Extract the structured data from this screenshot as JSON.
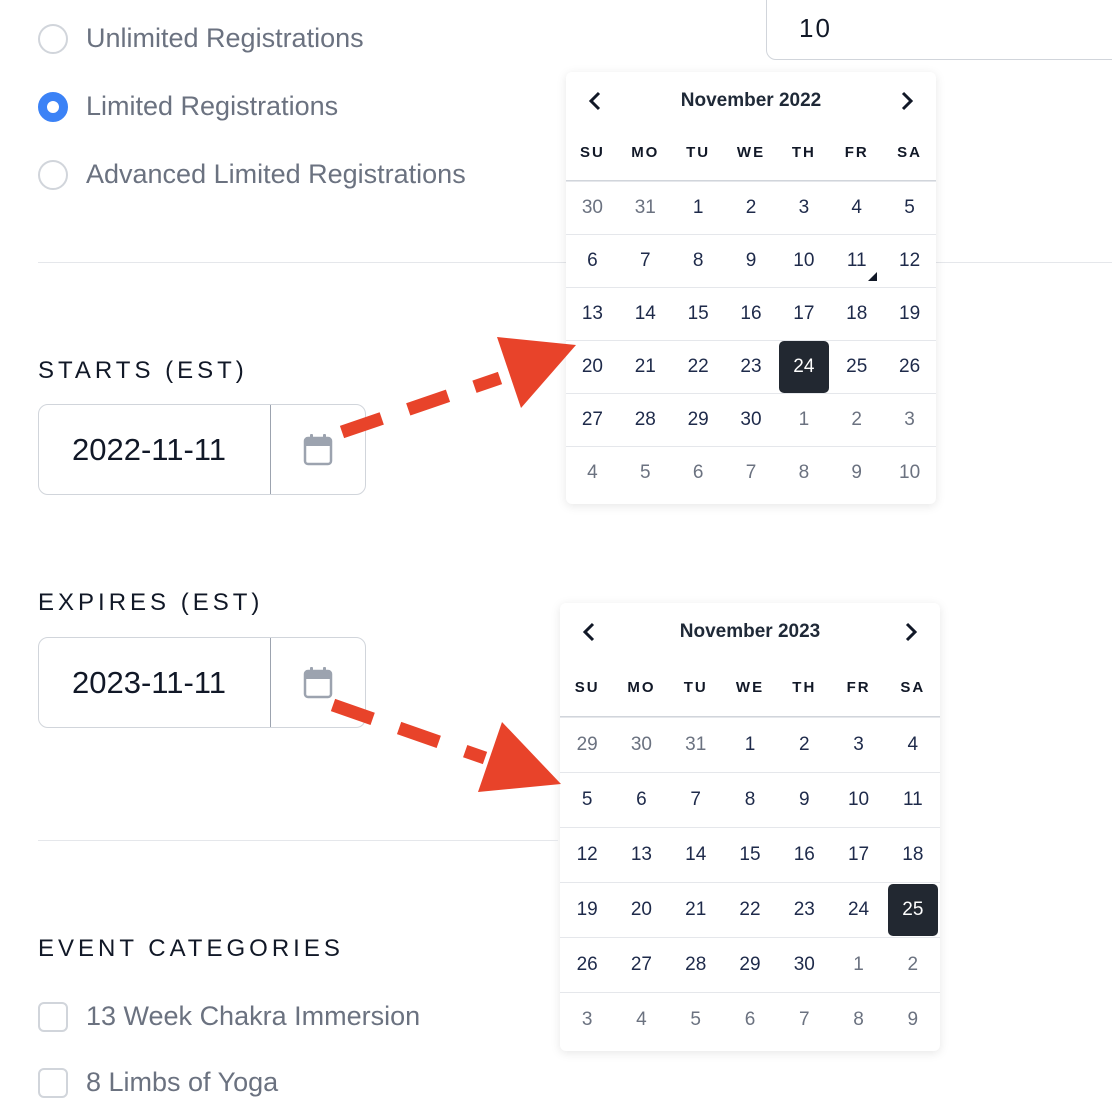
{
  "registration": {
    "options": [
      {
        "label": "Unlimited Registrations",
        "checked": false
      },
      {
        "label": "Limited Registrations",
        "checked": true
      },
      {
        "label": "Advanced Limited Registrations",
        "checked": false
      }
    ],
    "limit_value": "10"
  },
  "starts": {
    "label": "STARTS (EST)",
    "value": "2022-11-11",
    "calendar": {
      "title": "November 2022",
      "dow": [
        "SU",
        "MO",
        "TU",
        "WE",
        "TH",
        "FR",
        "SA"
      ],
      "days": [
        "30",
        "31",
        "1",
        "2",
        "3",
        "4",
        "5",
        "6",
        "7",
        "8",
        "9",
        "10",
        "11",
        "12",
        "13",
        "14",
        "15",
        "16",
        "17",
        "18",
        "19",
        "20",
        "21",
        "22",
        "23",
        "24",
        "25",
        "26",
        "27",
        "28",
        "29",
        "30",
        "1",
        "2",
        "3",
        "4",
        "5",
        "6",
        "7",
        "8",
        "9",
        "10"
      ],
      "muted": [
        0,
        1,
        32,
        33,
        34,
        35,
        36,
        37,
        38,
        39,
        40,
        41
      ],
      "selected_index": 25,
      "marked_index": 12
    }
  },
  "expires": {
    "label": "EXPIRES (EST)",
    "value": "2023-11-11",
    "calendar": {
      "title": "November 2023",
      "dow": [
        "SU",
        "MO",
        "TU",
        "WE",
        "TH",
        "FR",
        "SA"
      ],
      "days": [
        "29",
        "30",
        "31",
        "1",
        "2",
        "3",
        "4",
        "5",
        "6",
        "7",
        "8",
        "9",
        "10",
        "11",
        "12",
        "13",
        "14",
        "15",
        "16",
        "17",
        "18",
        "19",
        "20",
        "21",
        "22",
        "23",
        "24",
        "25",
        "26",
        "27",
        "28",
        "29",
        "30",
        "1",
        "2",
        "3",
        "4",
        "5",
        "6",
        "7",
        "8",
        "9"
      ],
      "muted": [
        0,
        1,
        2,
        33,
        34,
        35,
        36,
        37,
        38,
        39,
        40,
        41
      ],
      "selected_index": 27
    }
  },
  "categories": {
    "label": "EVENT CATEGORIES",
    "items": [
      "13 Week Chakra Immersion",
      "8 Limbs of Yoga"
    ]
  },
  "colors": {
    "accent": "#3b82f6",
    "arrow": "#e8432a",
    "selected_day": "#222831"
  },
  "icons": [
    "calendar-icon",
    "chevron-left-icon",
    "chevron-right-icon"
  ]
}
